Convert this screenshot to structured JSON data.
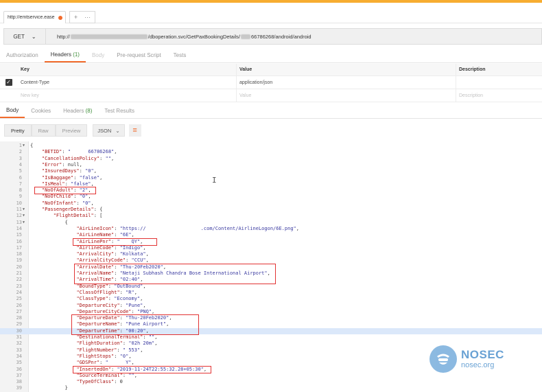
{
  "colors": {
    "accent": "#f26b2c",
    "highlight_box": "#e23232",
    "topbar": "#f7ad31"
  },
  "tab": {
    "url": "http://emtservice.ease"
  },
  "request": {
    "method": "GET",
    "url_prefix": "http://",
    "url_mid": "/dboperation.svc/GetPaxBookingDetails/",
    "url_id_tail": "66786268",
    "url_suffix": "/android/android"
  },
  "request_tabs": [
    {
      "label": "Authorization",
      "state": "normal"
    },
    {
      "label": "Headers",
      "count": "(1)",
      "state": "active"
    },
    {
      "label": "Body",
      "state": "dim"
    },
    {
      "label": "Pre-request Script",
      "state": "normal"
    },
    {
      "label": "Tests",
      "state": "normal"
    }
  ],
  "headers_table": {
    "columns": [
      "Key",
      "Value",
      "Description"
    ],
    "row": {
      "key": "Content-Type",
      "value": "application/json",
      "checked": true
    },
    "placeholders": {
      "key": "New key",
      "value": "Value",
      "description": "Description"
    }
  },
  "response_tabs": [
    {
      "label": "Body",
      "state": "active"
    },
    {
      "label": "Cookies",
      "state": "normal"
    },
    {
      "label": "Headers",
      "count": "(8)",
      "state": "normal"
    },
    {
      "label": "Test Results",
      "state": "normal"
    }
  ],
  "toolbar": {
    "pretty": "Pretty",
    "raw": "Raw",
    "preview": "Preview",
    "format": "JSON"
  },
  "code_lines": [
    {
      "n": "1",
      "fold": true,
      "t": "{"
    },
    {
      "n": "2",
      "t": "    \"BETID\": \"      66786268\","
    },
    {
      "n": "3",
      "t": "    \"CancellationPolicy\": \"\","
    },
    {
      "n": "4",
      "t": "    \"Error\": null,"
    },
    {
      "n": "5",
      "t": "    \"InsuredDays\": \"0\","
    },
    {
      "n": "6",
      "t": "    \"IsBaggage\": \"false\","
    },
    {
      "n": "7",
      "t": "    \"IsMeal\": \"false\","
    },
    {
      "n": "8",
      "t": "    \"NoOfAdult\": \"2\","
    },
    {
      "n": "9",
      "t": "    \"NoOfChild\": \"0\","
    },
    {
      "n": "10",
      "t": "    \"NoOfInfant\": \"0\","
    },
    {
      "n": "11",
      "fold": true,
      "t": "    \"PassengerDetails\": {"
    },
    {
      "n": "12",
      "fold": true,
      "t": "        \"FlightDetail\": ["
    },
    {
      "n": "13",
      "fold": true,
      "t": "            {"
    },
    {
      "n": "14",
      "t": "                \"AirLineIcon\": \"https://                   .com/Content/AirlineLogon/6E.png\","
    },
    {
      "n": "15",
      "t": "                \"AirLineName\": \"6E\","
    },
    {
      "n": "16",
      "t": "                \"AirLinePnr\": \"    QY\","
    },
    {
      "n": "17",
      "t": "                \"AirlineCode\": \"Indigo\","
    },
    {
      "n": "18",
      "t": "                \"ArrivalCity\": \"Kolkata\","
    },
    {
      "n": "19",
      "t": "                \"ArrivalCityCode\": \"CCU\","
    },
    {
      "n": "20",
      "t": "                \"ArrivalDate\": \"Thu-20Feb2020\","
    },
    {
      "n": "21",
      "t": "                \"ArrivalName\": \"Netaji Subhash Chandra Bose International Airport\","
    },
    {
      "n": "22",
      "t": "                \"ArrivalTime\": \"02:40\","
    },
    {
      "n": "23",
      "t": "                \"BoundType\": \"OutBound\","
    },
    {
      "n": "24",
      "t": "                \"ClassOfFlight\": \"R\","
    },
    {
      "n": "25",
      "t": "                \"ClassType\": \"Economy\","
    },
    {
      "n": "26",
      "t": "                \"DepartureCity\": \"Pune\","
    },
    {
      "n": "27",
      "t": "                \"DepartureCityCode\": \"PNQ\","
    },
    {
      "n": "28",
      "t": "                \"DepartureDate\": \"Thu-20Feb2020\","
    },
    {
      "n": "29",
      "t": "                \"DepartureName\": \"Pune Airport\","
    },
    {
      "n": "30",
      "t": "                \"DepartureTime\": \"00:20\",",
      "hl": true
    },
    {
      "n": "31",
      "t": "                \"DestinationalTerminal\": \"\","
    },
    {
      "n": "32",
      "t": "                \"FlightDuration\": \"02h 20m\","
    },
    {
      "n": "33",
      "t": "                \"FlightNumber\": \" 553\","
    },
    {
      "n": "34",
      "t": "                \"FlightStops\": \"0\","
    },
    {
      "n": "35",
      "t": "                \"GDSPnr\": \"      Y\","
    },
    {
      "n": "36",
      "t": "                \"InsertedOn\": \"2019-11-24T22:55:32.28+05:30\","
    },
    {
      "n": "37",
      "t": "                \"SourceTerminal\": \"\","
    },
    {
      "n": "38",
      "t": "                \"TypeOfClass\": 0"
    },
    {
      "n": "39",
      "t": "            }"
    }
  ],
  "logo": {
    "name": "NOSEC",
    "domain": "nosec.org"
  }
}
